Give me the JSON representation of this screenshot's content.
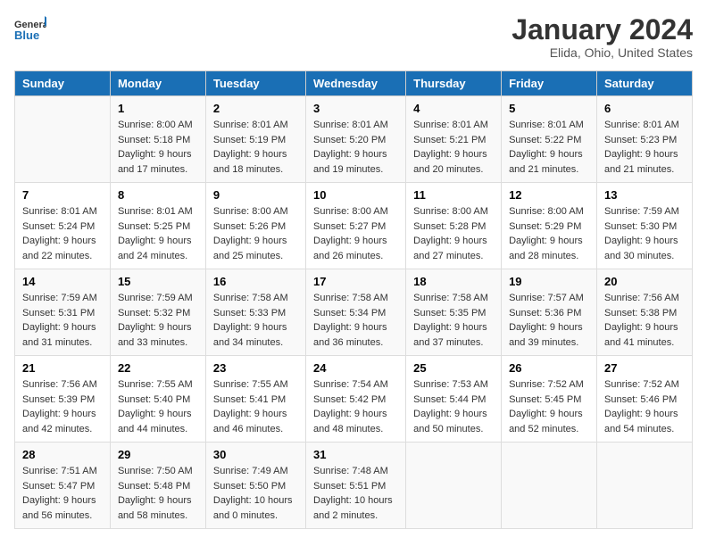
{
  "header": {
    "logo_line1": "General",
    "logo_line2": "Blue",
    "main_title": "January 2024",
    "subtitle": "Elida, Ohio, United States"
  },
  "days_of_week": [
    "Sunday",
    "Monday",
    "Tuesday",
    "Wednesday",
    "Thursday",
    "Friday",
    "Saturday"
  ],
  "weeks": [
    [
      {
        "day": "",
        "info": ""
      },
      {
        "day": "1",
        "info": "Sunrise: 8:00 AM\nSunset: 5:18 PM\nDaylight: 9 hours\nand 17 minutes."
      },
      {
        "day": "2",
        "info": "Sunrise: 8:01 AM\nSunset: 5:19 PM\nDaylight: 9 hours\nand 18 minutes."
      },
      {
        "day": "3",
        "info": "Sunrise: 8:01 AM\nSunset: 5:20 PM\nDaylight: 9 hours\nand 19 minutes."
      },
      {
        "day": "4",
        "info": "Sunrise: 8:01 AM\nSunset: 5:21 PM\nDaylight: 9 hours\nand 20 minutes."
      },
      {
        "day": "5",
        "info": "Sunrise: 8:01 AM\nSunset: 5:22 PM\nDaylight: 9 hours\nand 21 minutes."
      },
      {
        "day": "6",
        "info": "Sunrise: 8:01 AM\nSunset: 5:23 PM\nDaylight: 9 hours\nand 21 minutes."
      }
    ],
    [
      {
        "day": "7",
        "info": "Sunrise: 8:01 AM\nSunset: 5:24 PM\nDaylight: 9 hours\nand 22 minutes."
      },
      {
        "day": "8",
        "info": "Sunrise: 8:01 AM\nSunset: 5:25 PM\nDaylight: 9 hours\nand 24 minutes."
      },
      {
        "day": "9",
        "info": "Sunrise: 8:00 AM\nSunset: 5:26 PM\nDaylight: 9 hours\nand 25 minutes."
      },
      {
        "day": "10",
        "info": "Sunrise: 8:00 AM\nSunset: 5:27 PM\nDaylight: 9 hours\nand 26 minutes."
      },
      {
        "day": "11",
        "info": "Sunrise: 8:00 AM\nSunset: 5:28 PM\nDaylight: 9 hours\nand 27 minutes."
      },
      {
        "day": "12",
        "info": "Sunrise: 8:00 AM\nSunset: 5:29 PM\nDaylight: 9 hours\nand 28 minutes."
      },
      {
        "day": "13",
        "info": "Sunrise: 7:59 AM\nSunset: 5:30 PM\nDaylight: 9 hours\nand 30 minutes."
      }
    ],
    [
      {
        "day": "14",
        "info": "Sunrise: 7:59 AM\nSunset: 5:31 PM\nDaylight: 9 hours\nand 31 minutes."
      },
      {
        "day": "15",
        "info": "Sunrise: 7:59 AM\nSunset: 5:32 PM\nDaylight: 9 hours\nand 33 minutes."
      },
      {
        "day": "16",
        "info": "Sunrise: 7:58 AM\nSunset: 5:33 PM\nDaylight: 9 hours\nand 34 minutes."
      },
      {
        "day": "17",
        "info": "Sunrise: 7:58 AM\nSunset: 5:34 PM\nDaylight: 9 hours\nand 36 minutes."
      },
      {
        "day": "18",
        "info": "Sunrise: 7:58 AM\nSunset: 5:35 PM\nDaylight: 9 hours\nand 37 minutes."
      },
      {
        "day": "19",
        "info": "Sunrise: 7:57 AM\nSunset: 5:36 PM\nDaylight: 9 hours\nand 39 minutes."
      },
      {
        "day": "20",
        "info": "Sunrise: 7:56 AM\nSunset: 5:38 PM\nDaylight: 9 hours\nand 41 minutes."
      }
    ],
    [
      {
        "day": "21",
        "info": "Sunrise: 7:56 AM\nSunset: 5:39 PM\nDaylight: 9 hours\nand 42 minutes."
      },
      {
        "day": "22",
        "info": "Sunrise: 7:55 AM\nSunset: 5:40 PM\nDaylight: 9 hours\nand 44 minutes."
      },
      {
        "day": "23",
        "info": "Sunrise: 7:55 AM\nSunset: 5:41 PM\nDaylight: 9 hours\nand 46 minutes."
      },
      {
        "day": "24",
        "info": "Sunrise: 7:54 AM\nSunset: 5:42 PM\nDaylight: 9 hours\nand 48 minutes."
      },
      {
        "day": "25",
        "info": "Sunrise: 7:53 AM\nSunset: 5:44 PM\nDaylight: 9 hours\nand 50 minutes."
      },
      {
        "day": "26",
        "info": "Sunrise: 7:52 AM\nSunset: 5:45 PM\nDaylight: 9 hours\nand 52 minutes."
      },
      {
        "day": "27",
        "info": "Sunrise: 7:52 AM\nSunset: 5:46 PM\nDaylight: 9 hours\nand 54 minutes."
      }
    ],
    [
      {
        "day": "28",
        "info": "Sunrise: 7:51 AM\nSunset: 5:47 PM\nDaylight: 9 hours\nand 56 minutes."
      },
      {
        "day": "29",
        "info": "Sunrise: 7:50 AM\nSunset: 5:48 PM\nDaylight: 9 hours\nand 58 minutes."
      },
      {
        "day": "30",
        "info": "Sunrise: 7:49 AM\nSunset: 5:50 PM\nDaylight: 10 hours\nand 0 minutes."
      },
      {
        "day": "31",
        "info": "Sunrise: 7:48 AM\nSunset: 5:51 PM\nDaylight: 10 hours\nand 2 minutes."
      },
      {
        "day": "",
        "info": ""
      },
      {
        "day": "",
        "info": ""
      },
      {
        "day": "",
        "info": ""
      }
    ]
  ]
}
